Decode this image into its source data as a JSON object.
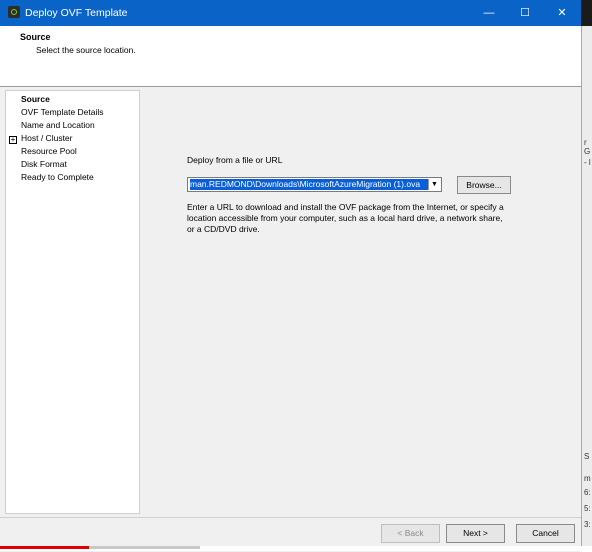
{
  "window": {
    "title": "Deploy OVF Template",
    "minimize_glyph": "—",
    "maximize_glyph": "☐",
    "close_glyph": "✕"
  },
  "header": {
    "title": "Source",
    "subtitle": "Select the source location."
  },
  "steps": [
    {
      "label": "Source",
      "active": true
    },
    {
      "label": "OVF Template Details"
    },
    {
      "label": "Name and Location"
    },
    {
      "label": "Host / Cluster",
      "expandable": true
    },
    {
      "label": "Resource Pool"
    },
    {
      "label": "Disk Format"
    },
    {
      "label": "Ready to Complete"
    }
  ],
  "expand_glyph": "+",
  "content": {
    "deploy_label": "Deploy from a file or URL",
    "path_value": "man.REDMOND\\Downloads\\MicrosoftAzureMigration (1).ova",
    "dropdown_glyph": "▼",
    "browse_label": "Browse...",
    "description": "Enter a URL to download and install the OVF package from the Internet, or specify a location accessible from your computer, such as a local hard drive, a network share, or a CD/DVD drive."
  },
  "footer": {
    "back_label": "< Back",
    "next_label": "Next >",
    "cancel_label": "Cancel"
  },
  "background_strip": [
    "r G",
    "- l",
    "S",
    "m",
    "6:",
    "5:",
    "3:"
  ],
  "playback_progress": 0.15,
  "colors": {
    "titlebar": "#0a64c8",
    "selection": "#0a5fd8",
    "progress": "#e00000"
  }
}
